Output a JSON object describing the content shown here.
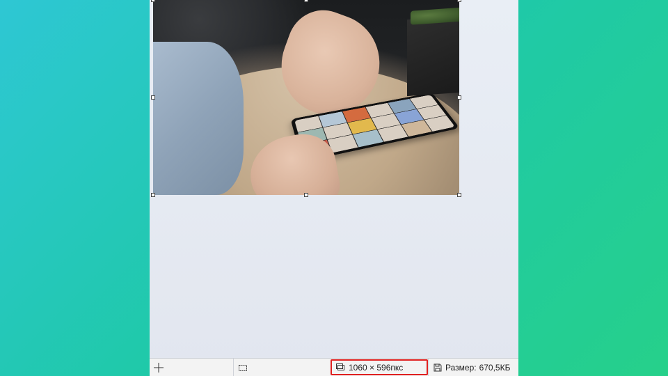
{
  "statusbar": {
    "position_value": "",
    "selection_value": "",
    "dimensions_value": "1060 × 596пкс",
    "size_label": "Размер:",
    "size_value": "670,5КБ"
  },
  "icons": {
    "crosshair": "crosshair-icon",
    "selection": "selection-size-icon",
    "canvas": "canvas-size-icon",
    "disk": "disk-icon"
  }
}
